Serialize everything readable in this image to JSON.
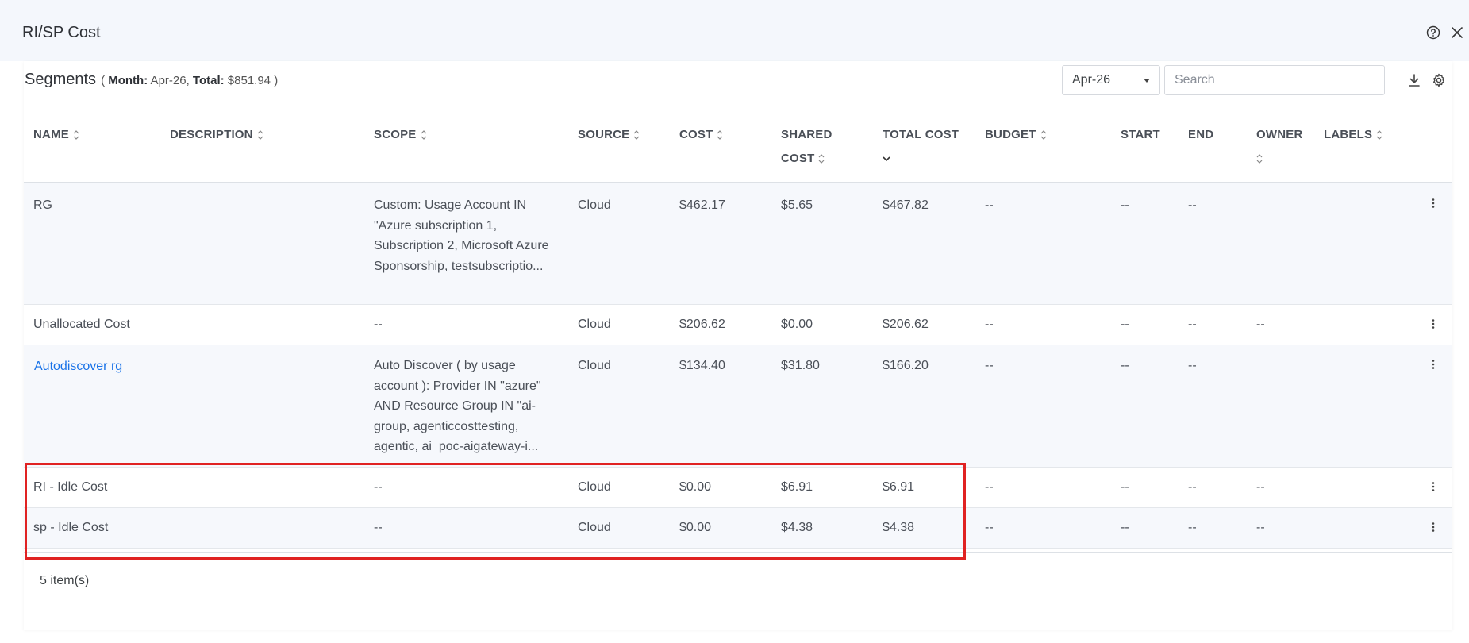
{
  "modal": {
    "title": "RI/SP Cost"
  },
  "segments": {
    "title": "Segments",
    "meta_open": "( ",
    "month_label": "Month:",
    "month_value": " Apr-26, ",
    "total_label": "Total:",
    "total_value": " $851.94 )"
  },
  "controls": {
    "month_selected": "Apr-26",
    "search_placeholder": "Search"
  },
  "columns": {
    "name": "NAME",
    "description": "DESCRIPTION",
    "scope": "SCOPE",
    "source": "SOURCE",
    "cost": "COST",
    "shared_cost_1": "SHARED",
    "shared_cost_2": "COST",
    "total_cost_1": "TOTAL COST",
    "budget": "BUDGET",
    "start": "START",
    "end": "END",
    "owner": "OWNER",
    "labels": "LABELS"
  },
  "rows": [
    {
      "name": "RG",
      "scope": "Custom: Usage Account IN \"Azure subscription 1, Subscription 2, Microsoft Azure Sponsorship, testsubscriptio...",
      "source": "Cloud",
      "cost": "$462.17",
      "shared_cost": "$5.65",
      "total_cost": "$467.82",
      "budget": "--",
      "start": "--",
      "end": "--"
    },
    {
      "name": "Unallocated Cost",
      "scope": "--",
      "source": "Cloud",
      "cost": "$206.62",
      "shared_cost": "$0.00",
      "total_cost": "$206.62",
      "budget": "--",
      "start": "--",
      "end": "--",
      "owner": "--"
    },
    {
      "name": "Autodiscover rg",
      "scope": "Auto Discover ( by usage account ): Provider IN \"azure\" AND Resource Group IN \"ai-group, agenticcosttesting, agentic, ai_poc-aigateway-i...",
      "source": "Cloud",
      "cost": "$134.40",
      "shared_cost": "$31.80",
      "total_cost": "$166.20",
      "budget": "--",
      "start": "--",
      "end": "--"
    },
    {
      "name": "RI - Idle Cost",
      "scope": "--",
      "source": "Cloud",
      "cost": "$0.00",
      "shared_cost": "$6.91",
      "total_cost": "$6.91",
      "budget": "--",
      "start": "--",
      "end": "--",
      "owner": "--"
    },
    {
      "name": "sp - Idle Cost",
      "scope": "--",
      "source": "Cloud",
      "cost": "$0.00",
      "shared_cost": "$4.38",
      "total_cost": "$4.38",
      "budget": "--",
      "start": "--",
      "end": "--",
      "owner": "--"
    }
  ],
  "footer": {
    "item_count": "5 item(s)"
  },
  "icons": {
    "help": "help-circle-icon",
    "close": "close-icon",
    "download": "download-icon",
    "settings": "gear-icon",
    "sort": "sort-icon",
    "row_menu": "kebab-menu-icon"
  },
  "colors": {
    "header_bg": "#f4f7fc",
    "link": "#1a73e8",
    "highlight": "#e02222"
  }
}
